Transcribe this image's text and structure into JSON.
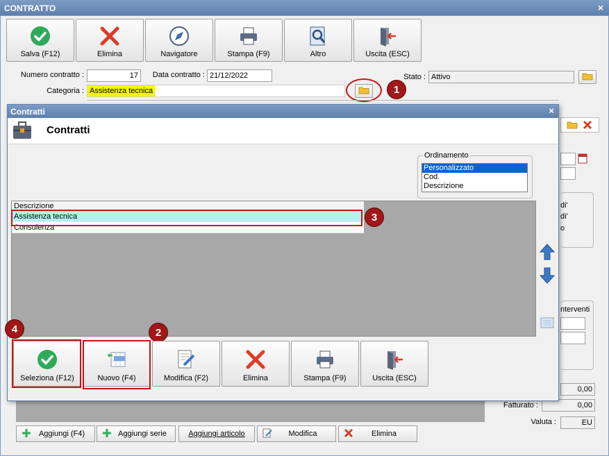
{
  "window": {
    "title": "CONTRATTO",
    "close_glyph": "×"
  },
  "toolbar": {
    "save_label": "Salva (F12)",
    "delete_label": "Elimina",
    "navigator_label": "Navigatore",
    "print_label": "Stampa (F9)",
    "more_label": "Altro",
    "exit_label": "Uscita (ESC)"
  },
  "form": {
    "contract_number_label": "Numero contratto :",
    "contract_number_value": "17",
    "contract_date_label": "Data contratto :",
    "contract_date_value": "21/12/2022",
    "status_label": "Stato :",
    "status_value": "Attivo",
    "category_label": "Categoria :",
    "category_value": "Assistenza tecnica"
  },
  "background_fragments": {
    "di1": "di'",
    "di2": "di'",
    "o": "o",
    "interventi": "nterventi",
    "amount1": "0,00",
    "invoiced_label": "Fatturato :",
    "invoiced_value": "0,00",
    "currency_label": "Valuta :",
    "currency_value": "EU"
  },
  "bottom_bar": {
    "add_label": "Aggiungi (F4)",
    "add_series_label": "Aggiungi serie",
    "add_article_label": "Aggiungi articolo",
    "edit_label": "Modifica",
    "delete_label": "Elimina"
  },
  "dialog": {
    "title": "Contratti",
    "close_glyph": "×",
    "header_title": "Contratti",
    "ordering": {
      "legend": "Ordinamento",
      "options": [
        "Personalizzato",
        "Cod.",
        "Descrizione"
      ],
      "selected": "Personalizzato"
    },
    "grid": {
      "column_header": "Descrizione",
      "rows": [
        "Assistenza tecnica",
        "Consulenza"
      ],
      "selected_row": "Assistenza tecnica"
    },
    "buttons": {
      "select_label": "Seleziona (F12)",
      "new_label": "Nuovo (F4)",
      "edit_label": "Modifica (F2)",
      "delete_label": "Elimina",
      "print_label": "Stampa (F9)",
      "exit_label": "Uscita (ESC)"
    }
  },
  "annotations": {
    "step1": "1",
    "step2": "2",
    "step3": "3",
    "step4": "4"
  },
  "colors": {
    "title_bar": "#6a8ab6",
    "highlight_yellow": "#f5f50a",
    "selected_row": "#b4f0f0",
    "annotation_red": "#c81414",
    "list_selection": "#0a64d2"
  }
}
